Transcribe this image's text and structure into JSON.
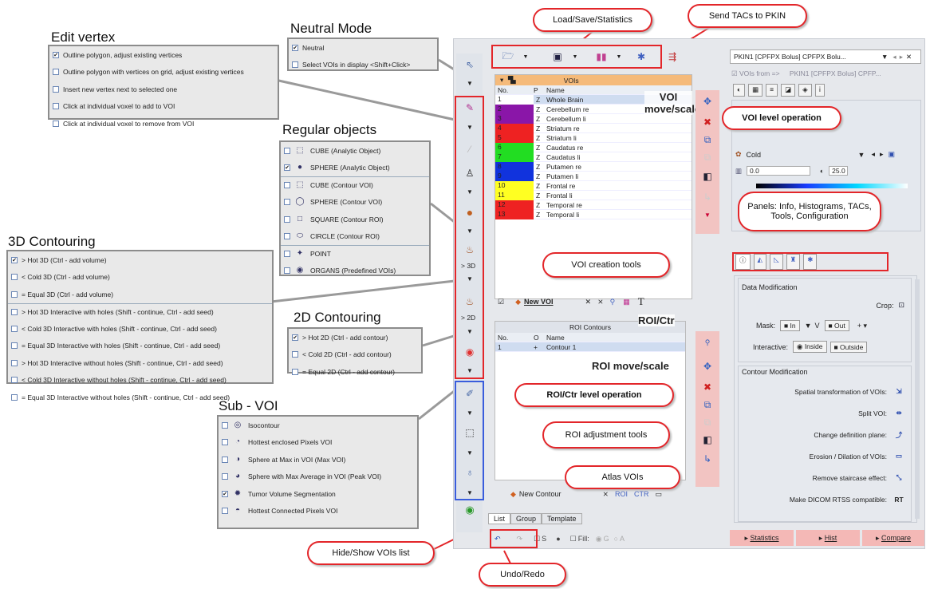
{
  "callouts": {
    "load_save": "Load/Save/Statistics",
    "send_tacs": "Send TACs to PKIN",
    "voi_level": "VOI level operation",
    "panels": "Panels: Info, Histograms, TACs, Tools, Configuration",
    "voi_creation": "VOI creation tools",
    "roi_level": "ROI/Ctr level operation",
    "roi_adjust": "ROI adjustment tools",
    "atlas": "Atlas VOIs",
    "hide_show": "Hide/Show VOIs list",
    "undo_redo": "Undo/Redo"
  },
  "edit_vertex": {
    "title": "Edit vertex",
    "items": [
      {
        "label": "Outline polygon, adjust existing vertices",
        "checked": true
      },
      {
        "label": "Outline polygon with vertices on grid, adjust existing vertices",
        "checked": false
      },
      {
        "label": "Insert new vertex next to selected one",
        "checked": false
      },
      {
        "label": "Click at individual voxel to add to VOI",
        "checked": false
      },
      {
        "label": "Click at individual voxel to remove from VOI",
        "checked": false
      }
    ]
  },
  "neutral_mode": {
    "title": "Neutral Mode",
    "items": [
      {
        "label": "Neutral",
        "checked": true
      },
      {
        "label": "Select VOIs in display <Shift+Click>",
        "checked": false
      }
    ]
  },
  "regular_objects": {
    "title": "Regular objects",
    "items": [
      {
        "label": "CUBE (Analytic Object)",
        "checked": false,
        "icon": "cube-icon"
      },
      {
        "label": "SPHERE (Analytic Object)",
        "checked": true,
        "icon": "sphere-icon"
      },
      {
        "label": "CUBE (Contour VOI)",
        "checked": false,
        "icon": "cube-outline-icon"
      },
      {
        "label": "SPHERE (Contour VOI)",
        "checked": false,
        "icon": "circle-icon"
      },
      {
        "label": "SQUARE (Contour ROI)",
        "checked": false,
        "icon": "square-icon"
      },
      {
        "label": "CIRCLE (Contour ROI)",
        "checked": false,
        "icon": "ellipse-icon"
      },
      {
        "label": "POINT",
        "checked": false,
        "icon": "point-icon"
      },
      {
        "label": "ORGANS (Predefined VOIs)",
        "checked": false,
        "icon": "organs-icon"
      }
    ]
  },
  "contouring_3d": {
    "title": "3D Contouring",
    "items": [
      {
        "label": "> Hot 3D (Ctrl - add volume)",
        "checked": true
      },
      {
        "label": "< Cold 3D (Ctrl - add volume)",
        "checked": false
      },
      {
        "label": "= Equal 3D (Ctrl - add volume)",
        "checked": false
      },
      {
        "label": "> Hot 3D Interactive with holes (Shift - continue, Ctrl - add seed)",
        "checked": false
      },
      {
        "label": "< Cold 3D Interactive with holes (Shift - continue, Ctrl - add seed)",
        "checked": false
      },
      {
        "label": "= Equal 3D Interactive with holes (Shift - continue, Ctrl - add seed)",
        "checked": false
      },
      {
        "label": "> Hot 3D Interactive without holes (Shift - continue, Ctrl - add seed)",
        "checked": false
      },
      {
        "label": "< Cold 3D Interactive without holes (Shift - continue, Ctrl - add seed)",
        "checked": false
      },
      {
        "label": "= Equal 3D Interactive without holes (Shift - continue, Ctrl - add seed)",
        "checked": false
      }
    ]
  },
  "contouring_2d": {
    "title": "2D Contouring",
    "items": [
      {
        "label": "> Hot 2D (Ctrl - add contour)",
        "checked": true
      },
      {
        "label": "< Cold 2D (Ctrl - add contour)",
        "checked": false
      },
      {
        "label": "= Equal 2D (Ctrl - add contour)",
        "checked": false
      }
    ]
  },
  "sub_voi": {
    "title": "Sub - VOI",
    "items": [
      {
        "label": "Isocontour",
        "checked": false
      },
      {
        "label": "Hottest enclosed Pixels VOI",
        "checked": false
      },
      {
        "label": "Sphere at Max in VOI (Max VOI)",
        "checked": false
      },
      {
        "label": "Sphere with Max Average in VOI (Peak VOI)",
        "checked": false
      },
      {
        "label": "Tumor Volume Segmentation",
        "checked": true
      },
      {
        "label": "Hottest Connected Pixels VOI",
        "checked": false
      }
    ]
  },
  "toolstrip": {
    "label_3d": "> 3D",
    "label_2d": "> 2D"
  },
  "vois_panel": {
    "header": "VOIs",
    "overlay_title": "VOI move/scale",
    "columns": [
      "No.",
      "P",
      "Name"
    ],
    "rows": [
      {
        "no": "1",
        "p": "Z",
        "name": "Whole Brain",
        "color": "#ffffff"
      },
      {
        "no": "2",
        "p": "Z",
        "name": "Cerebellum re",
        "color": "#8a16a8"
      },
      {
        "no": "3",
        "p": "Z",
        "name": "Cerebellum li",
        "color": "#8a16a8"
      },
      {
        "no": "4",
        "p": "Z",
        "name": "Striatum re",
        "color": "#ee2222"
      },
      {
        "no": "5",
        "p": "Z",
        "name": "Striatum li",
        "color": "#ee2222"
      },
      {
        "no": "6",
        "p": "Z",
        "name": "Caudatus re",
        "color": "#22dd22"
      },
      {
        "no": "7",
        "p": "Z",
        "name": "Caudatus li",
        "color": "#22dd22"
      },
      {
        "no": "8",
        "p": "Z",
        "name": "Putamen re",
        "color": "#1133dd"
      },
      {
        "no": "9",
        "p": "Z",
        "name": "Putamen li",
        "color": "#1133dd"
      },
      {
        "no": "10",
        "p": "Z",
        "name": "Frontal re",
        "color": "#ffff22"
      },
      {
        "no": "11",
        "p": "Z",
        "name": "Frontal li",
        "color": "#ffff22"
      },
      {
        "no": "12",
        "p": "Z",
        "name": "Temporal re",
        "color": "#ee2222"
      },
      {
        "no": "13",
        "p": "Z",
        "name": "Temporal li",
        "color": "#ee2222"
      }
    ],
    "new_voi": "New VOI"
  },
  "roi_panel": {
    "overlay_title": "ROI/Ctr",
    "header": "ROI Contours",
    "columns": [
      "No.",
      "O",
      "Name"
    ],
    "rows": [
      {
        "no": "1",
        "o": "+",
        "name": "Contour 1"
      }
    ],
    "move_scale": "ROI move/scale",
    "new_contour": "New Contour"
  },
  "bottom_tabs": [
    "List",
    "Group",
    "Template"
  ],
  "bottom_bar": {
    "s_label": "S",
    "fill_label": "Fill:",
    "g_label": "G",
    "a_label": "A"
  },
  "right_panel": {
    "combo": "PKIN1 [CPFPX Bolus] CPFPX Bolu...",
    "vois_from": "VOIs from =>",
    "vois_from_value": "PKIN1 [CPFPX Bolus] CPFP...",
    "colormap": "Cold",
    "min": "0.0",
    "max": "25.0",
    "data_mod_title": "Data Modification",
    "crop": "Crop:",
    "mask": "Mask:",
    "mask_in": "In",
    "mask_v": "V",
    "mask_out": "Out",
    "interactive": "Interactive:",
    "inside": "Inside",
    "outside": "Outside",
    "contour_mod_title": "Contour Modification",
    "ops": [
      "Spatial transformation of VOIs:",
      "Split VOI:",
      "Change definition plane:",
      "Erosion / Dilation of VOIs:",
      "Remove staircase effect:",
      "Make DICOM RTSS compatible:"
    ],
    "rt_label": "RT",
    "buttons": [
      "Statistics",
      "Hist",
      "Compare"
    ]
  }
}
